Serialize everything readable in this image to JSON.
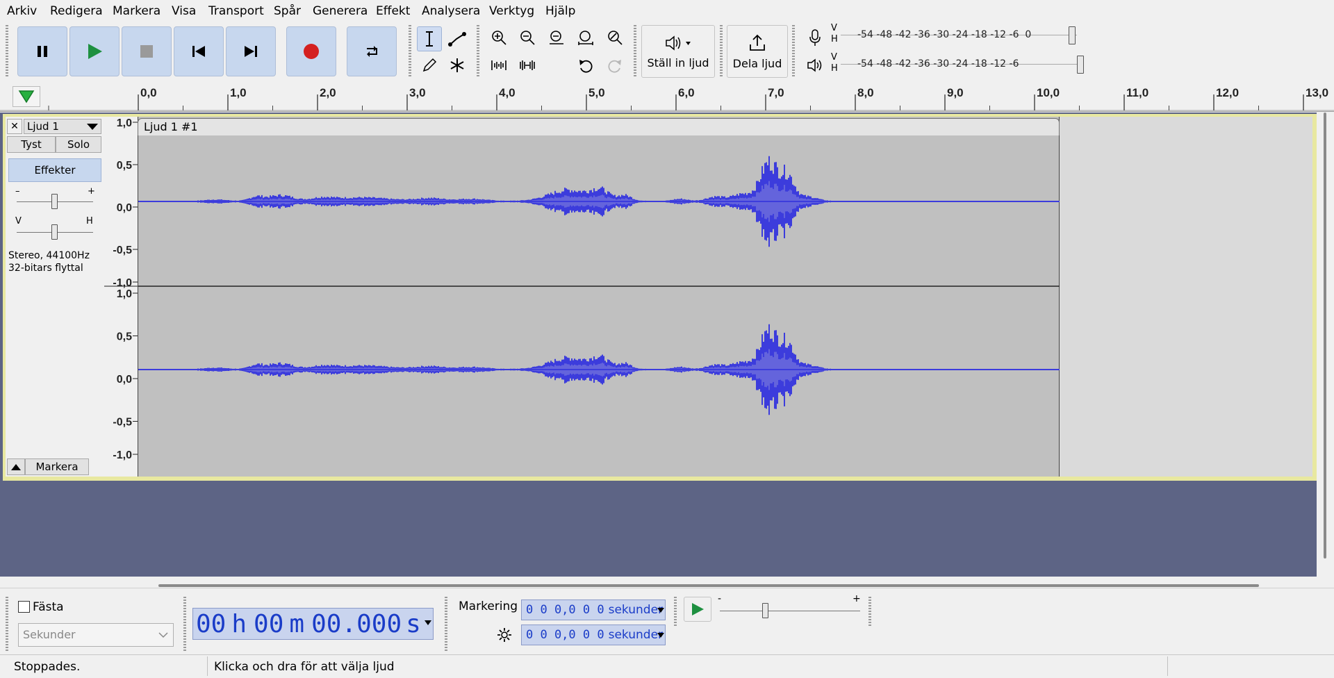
{
  "menu": [
    "Arkiv",
    "Redigera",
    "Markera",
    "Visa",
    "Transport",
    "Spår",
    "Generera",
    "Effekt",
    "Analysera",
    "Verktyg",
    "Hjälp"
  ],
  "toolbar": {
    "audio_setup_label": "Ställ in ljud",
    "share_audio_label": "Dela ljud",
    "meter_rec_ticks": "-54 -48 -42 -36 -30 -24 -18 -12 -6  0",
    "meter_play_ticks": "-54 -48 -42 -36 -30 -24 -18 -12 -6",
    "meter_v": "V",
    "meter_h": "H"
  },
  "ruler": {
    "ticks": [
      "0,0",
      "1,0",
      "2,0",
      "3,0",
      "4,0",
      "5,0",
      "6,0",
      "7,0",
      "8,0",
      "9,0",
      "10,0",
      "11,0",
      "12,0",
      "13,0"
    ]
  },
  "track": {
    "name": "Ljud 1",
    "close_glyph": "✕",
    "mute_label": "Tyst",
    "solo_label": "Solo",
    "effects_label": "Effekter",
    "gain_min": "–",
    "gain_max": "+",
    "pan_left": "V",
    "pan_right": "H",
    "info_line1": "Stereo, 44100Hz",
    "info_line2": "32-bitars flyttal",
    "select_label": "Markera",
    "clip_name": "Ljud 1 #1",
    "scale": [
      "1,0",
      "0,5",
      "0,0",
      "-0,5",
      "-1,0"
    ]
  },
  "bottom": {
    "snap_label": "Fästa",
    "snap_checked": false,
    "units_value": "Sekunder",
    "time": {
      "h": "00",
      "h_unit": "h",
      "m": "00",
      "m_unit": "m",
      "s": "00.000",
      "s_unit": "s"
    },
    "selection_label": "Markering",
    "sel_start": "0 0 0,0 0 0",
    "sel_end": "0 0 0,0 0 0",
    "sel_unit": "sekunder",
    "speed_min": "-",
    "speed_max": "+"
  },
  "status": {
    "state": "Stoppades.",
    "hint": "Klicka och dra för att välja ljud"
  },
  "colors": {
    "waveform": "#3c3cdc",
    "waveform_rms": "#6464dc",
    "clip_bg": "#c0c0c0",
    "track_selected_border": "#e8e8a0",
    "background": "#5d6485",
    "record": "#d42020",
    "play": "#1e9040"
  }
}
